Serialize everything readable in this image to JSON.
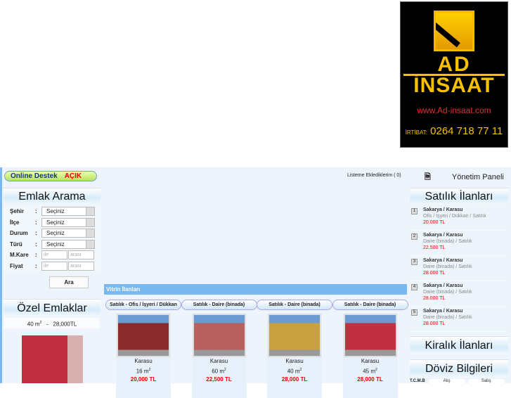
{
  "logo": {
    "text_ad": "AD",
    "text_insaat": "İNSAAT",
    "url": "www.Ad-insaat.com",
    "contact_label": "İRTİBAT:",
    "phone": "0264 718 77 11"
  },
  "online": {
    "label": "Online Destek",
    "status": "AÇIK"
  },
  "top": {
    "list_label": "Listeme Eklediklerim ( 0)",
    "admin": "Yönetim Paneli"
  },
  "search": {
    "title": "Emlak Arama",
    "fields": [
      {
        "label": "Şehir",
        "value": "Seçiniz"
      },
      {
        "label": "İlçe",
        "value": "Seçiniz"
      },
      {
        "label": "Durum",
        "value": "Seçiniz"
      },
      {
        "label": "Türü",
        "value": "Seçiniz"
      }
    ],
    "mkare": {
      "label": "M.Kare",
      "min": "ile",
      "max": "arası"
    },
    "fiyat": {
      "label": "Fiyat",
      "min": "ile",
      "max": "arası"
    },
    "colon": ":",
    "button": "Ara"
  },
  "ozel": {
    "title": "Özel Emlaklar",
    "area": "40 m",
    "sup": "2",
    "sep": "-",
    "price": "28,000TL"
  },
  "vitrin": {
    "title": "Vitrin İlanları",
    "items": [
      {
        "type": "Satılık - Ofis / İşyeri / Dükkan",
        "loc": "Karasu",
        "area": "16 m",
        "price": "20,000 TL",
        "color": "#8a2a2a"
      },
      {
        "type": "Satılık - Daire (binada)",
        "loc": "Karasu",
        "area": "60 m",
        "price": "22,500 TL",
        "color": "#b86060"
      },
      {
        "type": "Satılık - Daire (binada)",
        "loc": "Karasu",
        "area": "40 m",
        "price": "28,000 TL",
        "color": "#c8a040"
      },
      {
        "type": "Satılık - Daire (binada)",
        "loc": "Karasu",
        "area": "45 m",
        "price": "28,000 TL",
        "color": "#c03040"
      }
    ]
  },
  "satilik": {
    "title": "Satılık İlanları",
    "items": [
      {
        "n": "1",
        "loc": "Sakarya / Karasu",
        "type": "Ofis / İşyeri / Dükkan / Satılık",
        "price": "20.000 TL"
      },
      {
        "n": "2",
        "loc": "Sakarya / Karasu",
        "type": "Daire (binada) / Satılık",
        "price": "22.500 TL"
      },
      {
        "n": "3",
        "loc": "Sakarya / Karasu",
        "type": "Daire (binada) / Satılık",
        "price": "28.000 TL"
      },
      {
        "n": "4",
        "loc": "Sakarya / Karasu",
        "type": "Daire (binada) / Satılık",
        "price": "28.000 TL"
      },
      {
        "n": "5",
        "loc": "Sakarya / Karasu",
        "type": "Daire (binada) / Satılık",
        "price": "28.000 TL"
      }
    ]
  },
  "kiralik": {
    "title": "Kiralık İlanları"
  },
  "doviz": {
    "title": "Döviz Bilgileri",
    "cols": [
      "T.C.M.B",
      "Alış",
      "Satış"
    ]
  }
}
